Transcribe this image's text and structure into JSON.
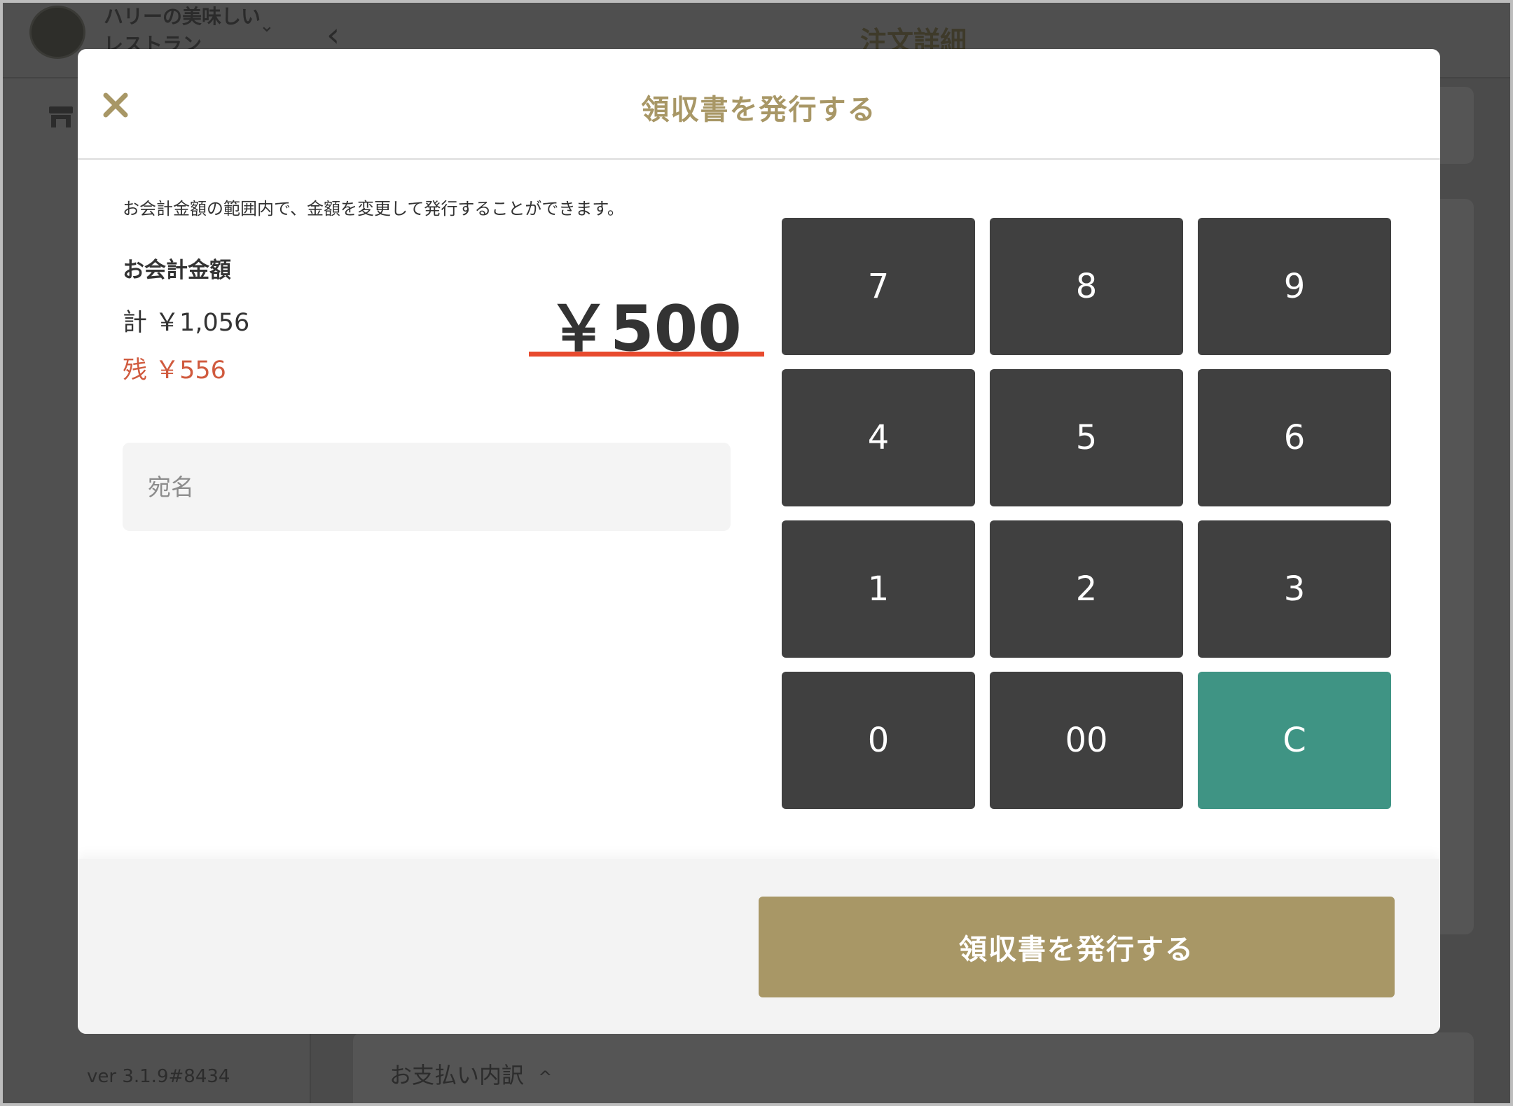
{
  "background": {
    "shop_name_line1": "ハリーの美味しい",
    "shop_name_line2": "レストラン",
    "page_title": "注文詳細",
    "version": "ver 3.1.9#8434",
    "payment_breakdown_label": "お支払い内訳"
  },
  "modal": {
    "title": "領収書を発行する",
    "hint": "お会計金額の範囲内で、金額を変更して発行することができます。",
    "total_label": "お会計金額",
    "total_sum": "計 ￥1,056",
    "remaining": "残 ￥556",
    "amount": "￥500",
    "recipient": {
      "value": "",
      "placeholder": "宛名"
    },
    "keypad": [
      "7",
      "8",
      "9",
      "4",
      "5",
      "6",
      "1",
      "2",
      "3",
      "0",
      "00",
      "C"
    ],
    "issue_button": "領収書を発行する"
  },
  "colors": {
    "accent_gold": "#a89766",
    "keypad_dark": "#404040",
    "clear_teal": "#3f9484",
    "remaining_red": "#d05a3e",
    "amount_underline": "#e84a2e"
  },
  "icons": {
    "close": "close-icon",
    "back": "chevron-left-icon",
    "store": "store-icon",
    "dropdown": "chevron-down-icon",
    "collapse": "chevron-up-icon"
  }
}
